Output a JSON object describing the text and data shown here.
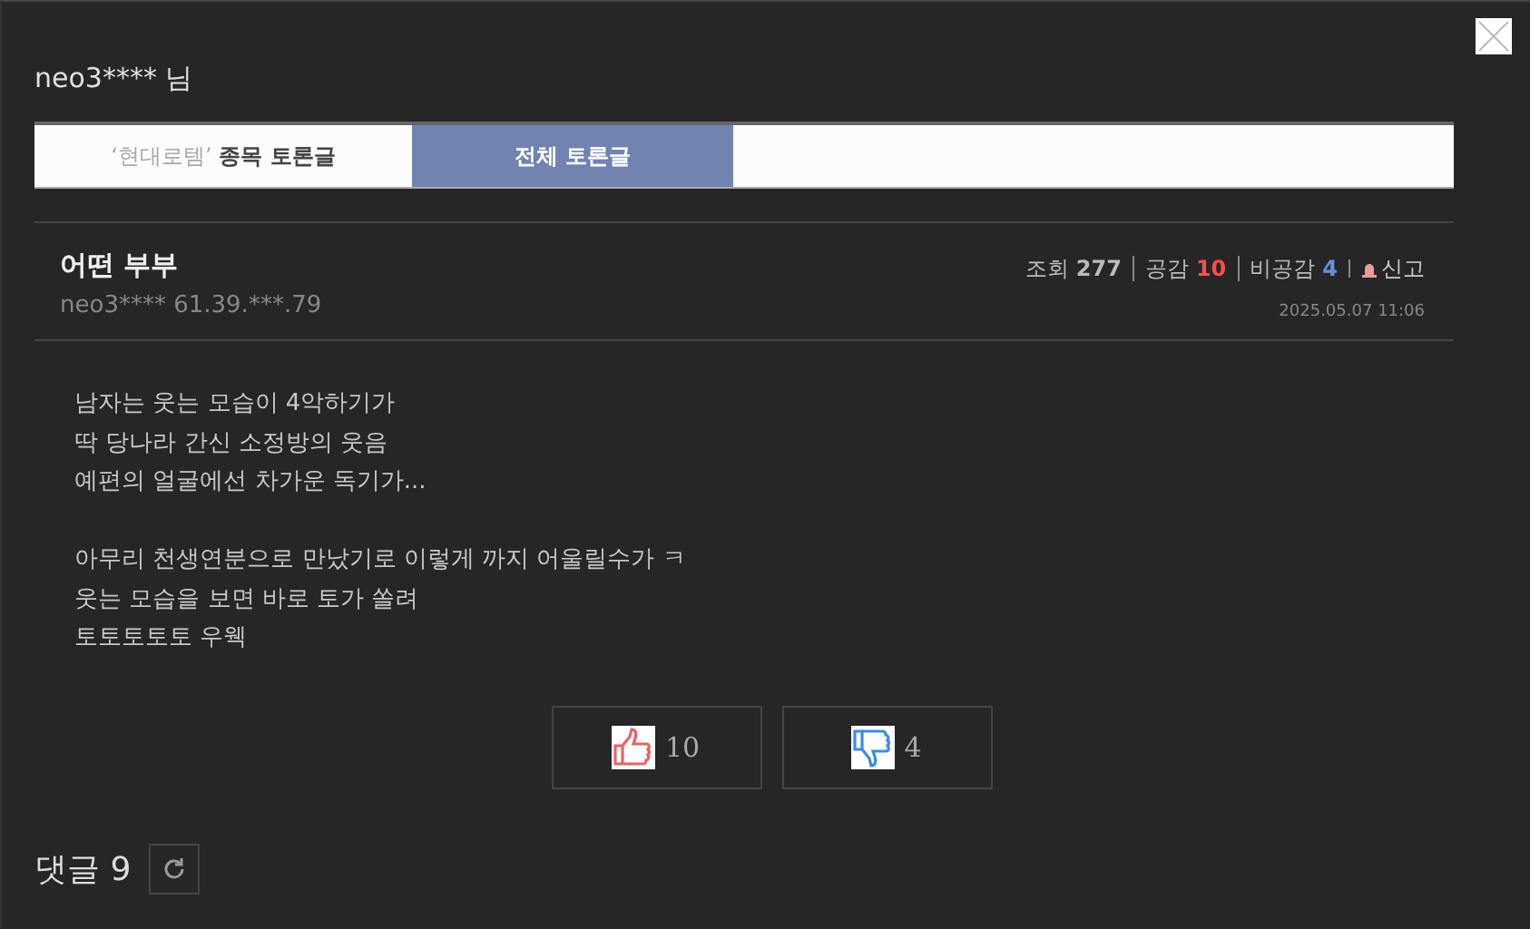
{
  "user_title": "neo3**** 님",
  "tabs": [
    {
      "label": "‘현대로템’ **종목 토론글**",
      "selected": false
    },
    {
      "label": "전체 토론글",
      "selected": true
    }
  ],
  "post": {
    "title": "어떤 부부",
    "author": "neo3**** 61.39.***.79",
    "stats": [
      {
        "label": "조회",
        "value": "277",
        "kind": "views"
      },
      {
        "label": "공감",
        "value": "10",
        "kind": "likes"
      },
      {
        "label": "비공감",
        "value": "4",
        "kind": "dislikes"
      }
    ],
    "report": "신고",
    "date": "2025.05.07 11:06",
    "paragraphs": [
      [
        "남자는 웃는 모습이 4악하기가",
        "딱 당나라 간신 소정방의 웃음",
        "예편의 얼굴에선 차가운 독기가..."
      ],
      [
        "아무리 천생연분으로 만났기로 이렇게 까지 어울릴수가 ㅋ",
        "웃는 모습을 보면 바로 토가 쏠려",
        "토토토토토 우웩"
      ]
    ],
    "votes": [
      {
        "kind": "like",
        "count": "10"
      },
      {
        "kind": "dislike",
        "count": "4"
      }
    ]
  },
  "comments": {
    "title": "댓글 9"
  }
}
